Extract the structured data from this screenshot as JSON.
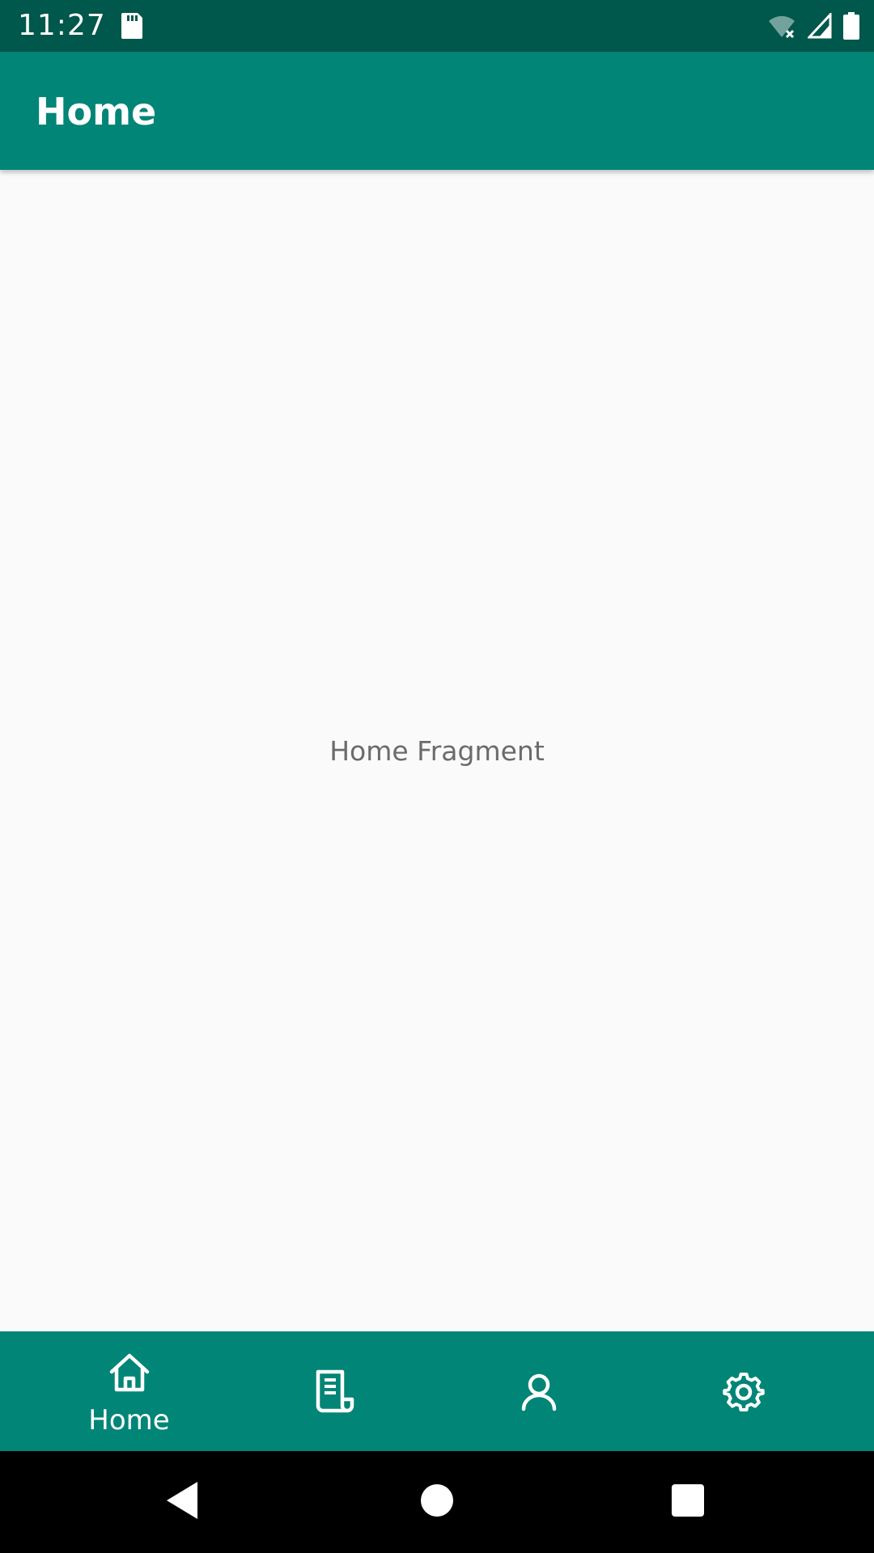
{
  "status_bar": {
    "time": "11:27",
    "icons": [
      "sd-card-icon",
      "wifi-off-icon",
      "cell-signal-icon",
      "battery-icon"
    ]
  },
  "app_bar": {
    "title": "Home"
  },
  "content": {
    "message": "Home Fragment"
  },
  "bottom_nav": {
    "items": [
      {
        "icon": "home-icon",
        "label": "Home",
        "selected": true
      },
      {
        "icon": "receipt-icon",
        "label": "",
        "selected": false
      },
      {
        "icon": "person-icon",
        "label": "",
        "selected": false
      },
      {
        "icon": "gear-icon",
        "label": "",
        "selected": false
      }
    ]
  },
  "system_nav": {
    "buttons": [
      "back-icon",
      "home-circle-icon",
      "recents-icon"
    ]
  },
  "colors": {
    "status_bar": "#00574b",
    "primary": "#008577",
    "background": "#fafafa",
    "text_secondary": "#6b6b6b"
  }
}
